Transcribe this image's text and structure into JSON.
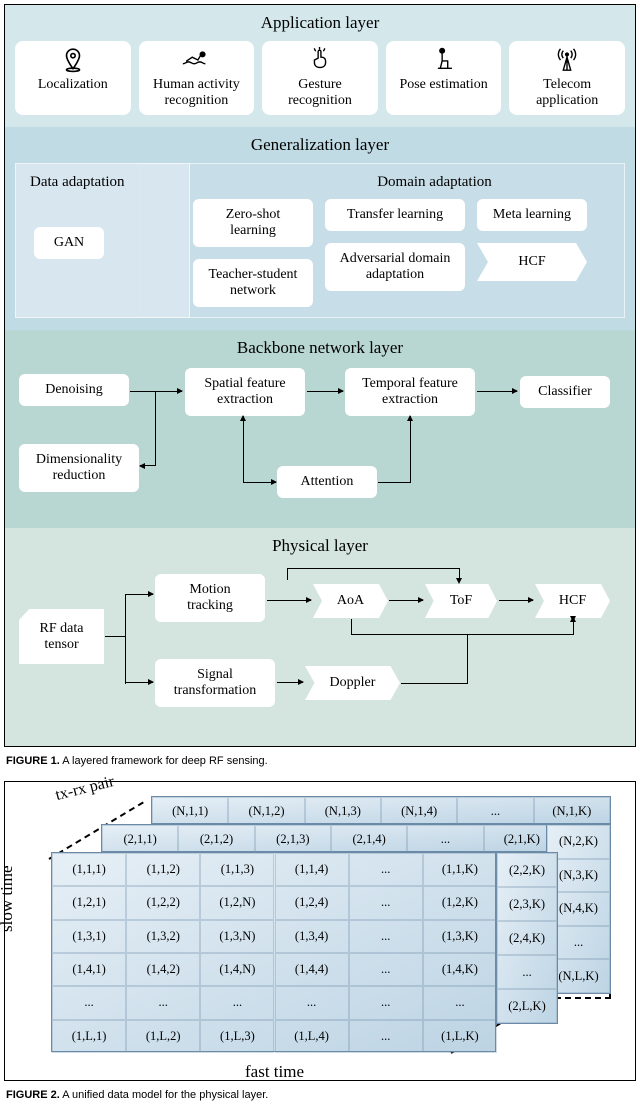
{
  "fig1": {
    "caption_label": "FIGURE 1.",
    "caption_text": " A layered framework for deep RF sensing.",
    "app": {
      "title": "Application layer",
      "items": [
        {
          "label": "Localization",
          "icon": "pin"
        },
        {
          "label": "Human activity recognition",
          "icon": "swim"
        },
        {
          "label": "Gesture recognition",
          "icon": "tap"
        },
        {
          "label": "Pose estimation",
          "icon": "sit"
        },
        {
          "label": "Telecom application",
          "icon": "antenna"
        }
      ]
    },
    "gen": {
      "title": "Generalization layer",
      "data_adapt": {
        "title": "Data adaptation",
        "items": [
          "GAN"
        ]
      },
      "domain_adapt": {
        "title": "Domain adaptation",
        "col1": [
          "Zero-shot learning",
          "Teacher-student network"
        ],
        "col2": [
          "Transfer learning",
          "Adversarial domain adaptation"
        ],
        "col3": [
          "Meta learning",
          "HCF"
        ]
      }
    },
    "back": {
      "title": "Backbone network layer",
      "denoise": "Denoising",
      "dimred": "Dimensionality reduction",
      "spatial": "Spatial feature extraction",
      "temporal": "Temporal feature extraction",
      "attention": "Attention",
      "classifier": "Classifier"
    },
    "phys": {
      "title": "Physical layer",
      "rf": "RF data tensor",
      "motion": "Motion tracking",
      "signal": "Signal transformation",
      "aoa": "AoA",
      "doppler": "Doppler",
      "tof": "ToF",
      "hcf": "HCF"
    }
  },
  "fig2": {
    "caption_label": "FIGURE 2.",
    "caption_text": " A unified data model for the physical layer.",
    "axes": {
      "slow": "slow time",
      "fast": "fast time",
      "pair": "tx-rx pair"
    },
    "top_back_row": [
      "(N,1,1)",
      "(N,1,2)",
      "(N,1,3)",
      "(N,1,4)",
      "...",
      "(N,1,K)"
    ],
    "top_mid_row": [
      "(2,1,1)",
      "(2,1,2)",
      "(2,1,3)",
      "(2,1,4)",
      "...",
      "(2,1,K)"
    ],
    "front_rows": [
      [
        "(1,1,1)",
        "(1,1,2)",
        "(1,1,3)",
        "(1,1,4)",
        "...",
        "(1,1,K)"
      ],
      [
        "(1,2,1)",
        "(1,2,2)",
        "(1,2,N)",
        "(1,2,4)",
        "...",
        "(1,2,K)"
      ],
      [
        "(1,3,1)",
        "(1,3,2)",
        "(1,3,N)",
        "(1,3,4)",
        "...",
        "(1,3,K)"
      ],
      [
        "(1,4,1)",
        "(1,4,2)",
        "(1,4,N)",
        "(1,4,4)",
        "...",
        "(1,4,K)"
      ],
      [
        "...",
        "...",
        "...",
        "...",
        "...",
        "..."
      ],
      [
        "(1,L,1)",
        "(1,L,2)",
        "(1,L,3)",
        "(1,L,4)",
        "...",
        "(1,L,K)"
      ]
    ],
    "side_mid_col": [
      "(2,2,K)",
      "(2,3,K)",
      "(2,4,K)",
      "...",
      "(2,L,K)"
    ],
    "side_back_col": [
      "(N,2,K)",
      "(N,3,K)",
      "(N,4,K)",
      "...",
      "(N,L,K)"
    ]
  }
}
